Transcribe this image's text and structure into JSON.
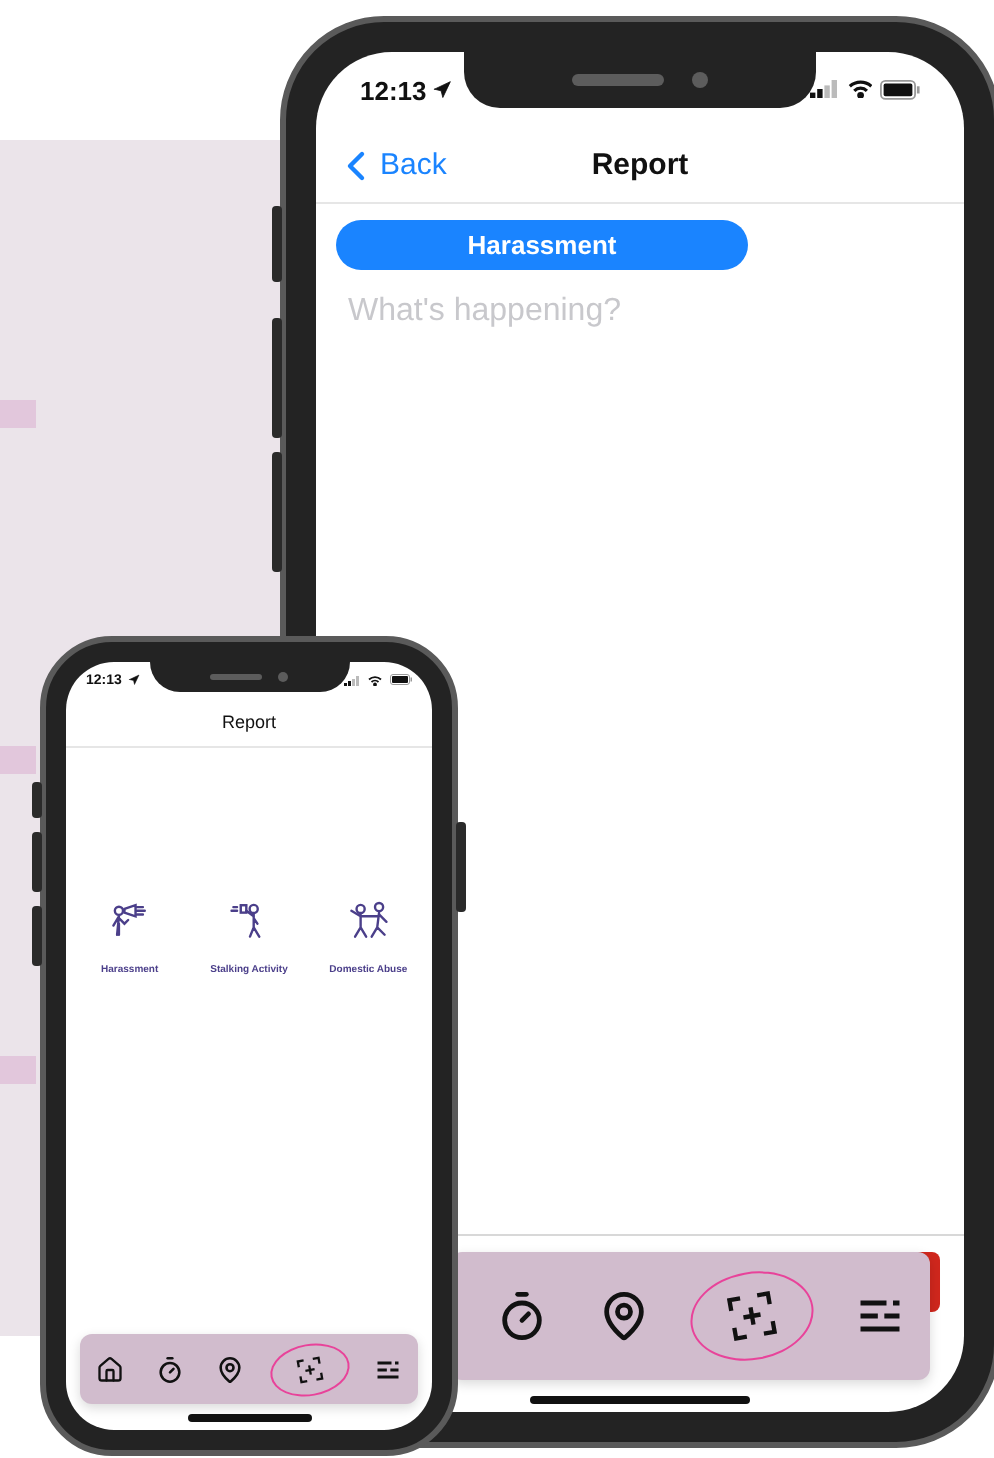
{
  "large_phone": {
    "status_time": "12:13",
    "nav": {
      "back": "Back",
      "title": "Report"
    },
    "category_chip": "Harassment",
    "message_field": {
      "placeholder": "What's happening?"
    },
    "tab_bar": [
      {
        "kind": "timer",
        "selected": false
      },
      {
        "kind": "pin",
        "selected": false
      },
      {
        "kind": "scan",
        "selected": true
      },
      {
        "kind": "menu",
        "selected": false
      }
    ]
  },
  "small_phone": {
    "status_time": "12:13",
    "title": "Report",
    "categories": [
      {
        "kind": "harassment",
        "label": "Harassment"
      },
      {
        "kind": "stalking",
        "label": "Stalking Activity"
      },
      {
        "kind": "abuse",
        "label": "Domestic Abuse"
      }
    ],
    "tab_bar": [
      {
        "kind": "home",
        "selected": false
      },
      {
        "kind": "timer",
        "selected": false
      },
      {
        "kind": "pin",
        "selected": false
      },
      {
        "kind": "scan",
        "selected": true
      },
      {
        "kind": "menu",
        "selected": false
      }
    ]
  }
}
